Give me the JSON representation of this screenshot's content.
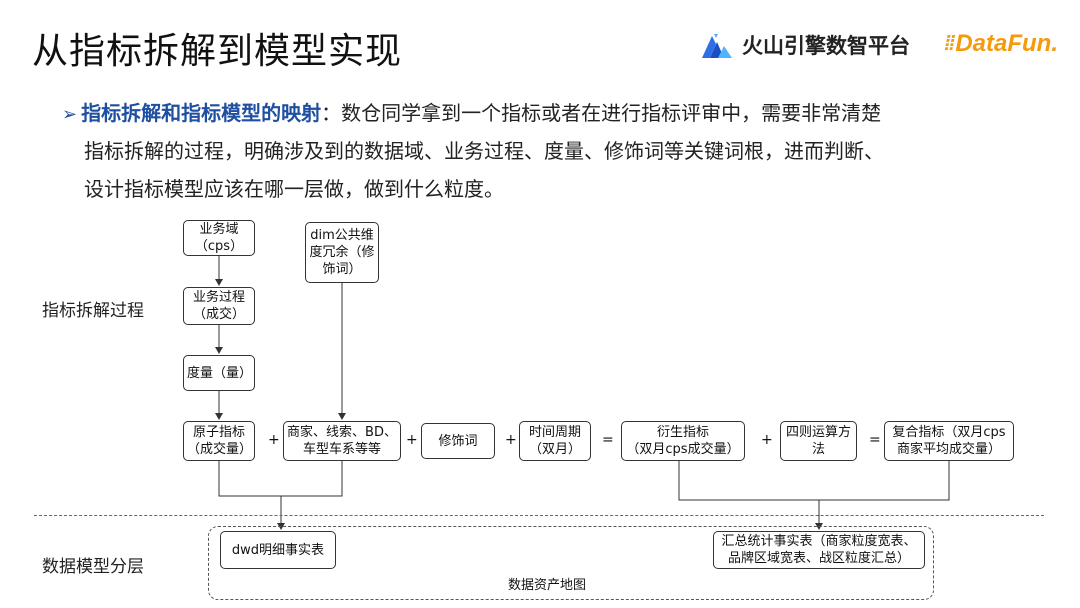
{
  "title": "从指标拆解到模型实现",
  "logos": {
    "volc_text": "火山引擎数智平台",
    "datafun_text": "DataFun."
  },
  "bullet": {
    "highlight": "指标拆解和指标模型的映射",
    "line1": "：数仓同学拿到一个指标或者在进行指标评审中，需要非常清楚",
    "line2": "指标拆解的过程，明确涉及到的数据域、业务过程、度量、修饰词等关键词根，进而判断、",
    "line3": "设计指标模型应该在哪一层做，做到什么粒度。"
  },
  "side_labels": {
    "decompose": "指标拆解过程",
    "layering": "数据模型分层"
  },
  "diagram": {
    "domain": "业务域\n（cps）",
    "process": "业务过程\n（成交）",
    "measure": "度量（量）",
    "dim": "dim公共维\n度冗余（修\n饰词）",
    "atomic": "原子指标\n（成交量）",
    "merchant": "商家、线索、BD、\n车型车系等等",
    "modifier": "修饰词",
    "period": "时间周期\n（双月）",
    "derived": "衍生指标\n（双月cps成交量）",
    "arith": "四则运算方\n法",
    "composite": "复合指标（双月cps\n商家平均成交量）",
    "dwd": "dwd明细事实表",
    "summary": "汇总统计事实表（商家粒度宽表、\n品牌区域宽表、战区粒度汇总）",
    "area_label": "数据资产地图",
    "ops": {
      "plus1": "+",
      "plus2": "+",
      "plus3": "+",
      "eq1": "=",
      "plus4": "+",
      "eq2": "="
    }
  }
}
